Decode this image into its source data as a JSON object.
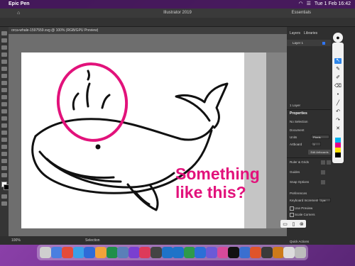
{
  "menubar": {
    "app_name": "Epic Pen",
    "datetime": "Tue 1 Feb 16:42"
  },
  "titlebar": {
    "title": "Illustrator 2019",
    "workspace": "Essentials"
  },
  "document": {
    "tab": "orca-whale-1597559.svg @ 100% (RGB/GPU Preview)"
  },
  "status": {
    "zoom": "100%",
    "tool": "Selection"
  },
  "panels": {
    "tabs": [
      "Layers",
      "Libraries"
    ],
    "layer_name": "Layer 1",
    "layer_count": "1 Layer",
    "properties_heading": "Properties",
    "no_selection": "No Selection",
    "document_label": "Document",
    "units_label": "Units",
    "units_value": "Pixels",
    "artboard_label": "Artboard",
    "artboard_value": "1",
    "edit_artboards": "Edit Artboards",
    "ruler_label": "Ruler & Grids",
    "guides_label": "Guides",
    "snap_label": "Snap Options",
    "preferences_label": "Preferences",
    "keyboard_label": "Keyboard Increment",
    "keyboard_value": "1 px",
    "use_preview": "Use Preview",
    "scale_corners": "Scale Corners",
    "quick_actions": "Quick Actions"
  },
  "annotation": {
    "line1": "Something",
    "line2": "like this?"
  },
  "epic_pen": {
    "colors": [
      "#00b4ef",
      "#e6008a",
      "#ffe100",
      "#000000"
    ]
  },
  "dock": {
    "icon_colors": [
      "#cfcfcf",
      "#4a7fe0",
      "#e44b3a",
      "#3aa0e8",
      "#2e6bd8",
      "#f2a23a",
      "#1f8f4a",
      "#5a7fb8",
      "#7a3fd0",
      "#dd3a5a",
      "#444444",
      "#1e73c8",
      "#1e73c8",
      "#2e9a4a",
      "#2b6fd6",
      "#6b5ad6",
      "#d64a9a",
      "#111111",
      "#3a6fd0",
      "#e0542a",
      "#3a3a3a",
      "#cc7a1a",
      "#dcdcdc",
      "#bcbcbc"
    ]
  }
}
